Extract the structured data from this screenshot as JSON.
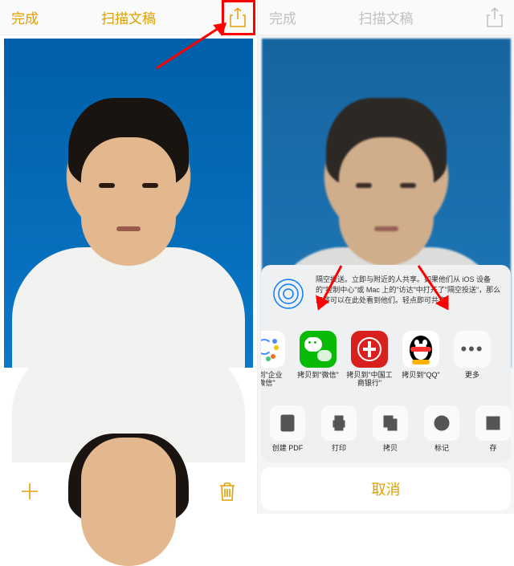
{
  "header": {
    "done": "完成",
    "title": "扫描文稿"
  },
  "airdrop_text": "隔空投送。立即与附近的人共享。如果他们从 iOS 设备的\"控制中心\"或 Mac 上的\"访达\"中打开了\"隔空投送\"，那么您将可以在此处看到他们。轻点即可共享。",
  "apps": {
    "ent_wechat_prefix": "贝到\"企业",
    "ent_wechat_suffix": "微信\"",
    "wechat": "拷贝到\"微信\"",
    "icbc_l1": "拷贝到\"中国工",
    "icbc_l2": "商银行\"",
    "qq": "拷贝到\"QQ\"",
    "more": "更多"
  },
  "actions": {
    "pdf": "创建 PDF",
    "print": "打印",
    "copy": "拷贝",
    "markup": "标记",
    "save": "存"
  },
  "cancel": "取消"
}
